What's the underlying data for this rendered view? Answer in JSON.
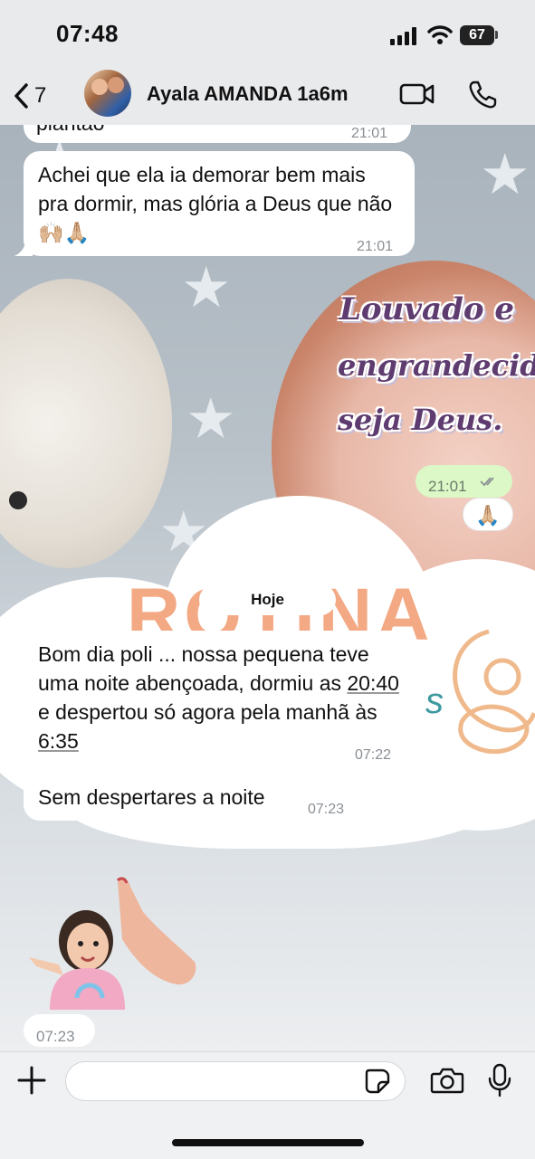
{
  "status_bar": {
    "time": "07:48",
    "battery": "67"
  },
  "header": {
    "back_count": "7",
    "contact_name": "Ayala AMANDA 1a6m"
  },
  "messages": {
    "m0": {
      "text": "plantão",
      "time": "21:01"
    },
    "m1": {
      "text": "Achei que ela ia demorar bem mais pra dormir, mas glória a Deus que não 🙌🏼🙏🏼",
      "time": "21:01"
    },
    "sticker": {
      "line1": "Louvado e",
      "line2": "engrandecido",
      "line3": "seja Deus.",
      "time": "21:01",
      "reaction": "🙏🏼"
    },
    "date_divider": "Hoje",
    "wallpaper_text": "ROTINA",
    "m2": {
      "p1": "Bom dia poli ... nossa pequena teve uma noite abençoada, dormiu as ",
      "t1": "20:40",
      "p2": " e despertou só agora pela manhã às ",
      "t2": "6:35",
      "time": "07:22"
    },
    "m3": {
      "text": "Sem despertares a noite",
      "time": "07:23"
    },
    "photo_sticker": {
      "time": "07:23"
    }
  },
  "colors": {
    "outgoing": "#dcf8c6",
    "incoming": "#ffffff",
    "read_ticks": "#8a8f94"
  }
}
